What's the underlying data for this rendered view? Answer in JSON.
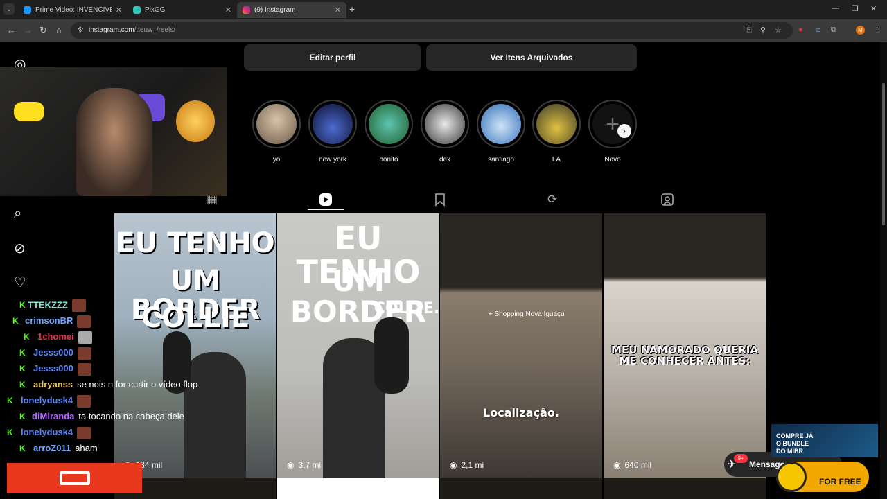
{
  "browser": {
    "tabs": [
      {
        "title": "Prime Video: INVENCÍVEL - TEM",
        "favicon_color": "#1a98ff"
      },
      {
        "title": "PixGG",
        "favicon_color": "#2ec4b6"
      },
      {
        "title": "(9) Instagram",
        "favicon_color": "#e1306c"
      }
    ],
    "url_domain": "instagram.com",
    "url_path": "/tteuw_/reels/",
    "profile_initial": "M"
  },
  "profile": {
    "edit_button": "Editar perfil",
    "archive_button": "Ver Itens Arquivados"
  },
  "highlights": [
    {
      "name": "yo",
      "color": "#b8a48c"
    },
    {
      "name": "new york",
      "color": "#15203f"
    },
    {
      "name": "bonito",
      "color": "#2e8a4a"
    },
    {
      "name": "dex",
      "color": "#8d8d8d"
    },
    {
      "name": "santiago",
      "color": "#4c86c7"
    },
    {
      "name": "LA",
      "color": "#7a6a3c"
    },
    {
      "name": "Novo",
      "color": "#121212"
    }
  ],
  "reels": [
    {
      "line1": "EU TENHO",
      "line2": "UM BORDER",
      "line3": "COLLIE",
      "views": "184 mil"
    },
    {
      "line1": "EU TENHO",
      "line2": "UM BORDER",
      "line3": "COLLIE.",
      "views": "3,7 mi"
    },
    {
      "caption": "Localização.",
      "location": "Shopping Nova Iguaçu",
      "views": "2,1 mi"
    },
    {
      "caption": "MEU NAMORADO QUERIA ME CONHECER ANTES:",
      "views": "640 mil"
    }
  ],
  "chat": [
    {
      "user": "TTEKZZZ",
      "color": "#7fe3d0",
      "msg": ""
    },
    {
      "user": "crimsonBR",
      "color": "#6fa8ff",
      "msg": ""
    },
    {
      "user": "1chomei",
      "color": "#e0334d",
      "msg": ""
    },
    {
      "user": "Jesss000",
      "color": "#5b86ff",
      "msg": ""
    },
    {
      "user": "Jesss000",
      "color": "#5b86ff",
      "msg": ""
    },
    {
      "user": "adryanss",
      "color": "#e8c36a",
      "msg": "se nois n for curtir o vídeo flop"
    },
    {
      "user": "lonelydusk4",
      "color": "#5b86ff",
      "msg": ""
    },
    {
      "user": "diMiranda",
      "color": "#b46bff",
      "msg": "ta tocando na cabeça dele"
    },
    {
      "user": "lonelydusk4",
      "color": "#5b86ff",
      "msg": ""
    },
    {
      "user": "arroZ011",
      "color": "#6fa8ff",
      "msg": "aham"
    }
  ],
  "messages": {
    "label": "Mensagens",
    "badge": "9+"
  },
  "promo": {
    "line1": "COMPRE JÁ",
    "line2": "O BUNDLE",
    "line3": "DO MIBR",
    "offer": "FOR FREE"
  }
}
